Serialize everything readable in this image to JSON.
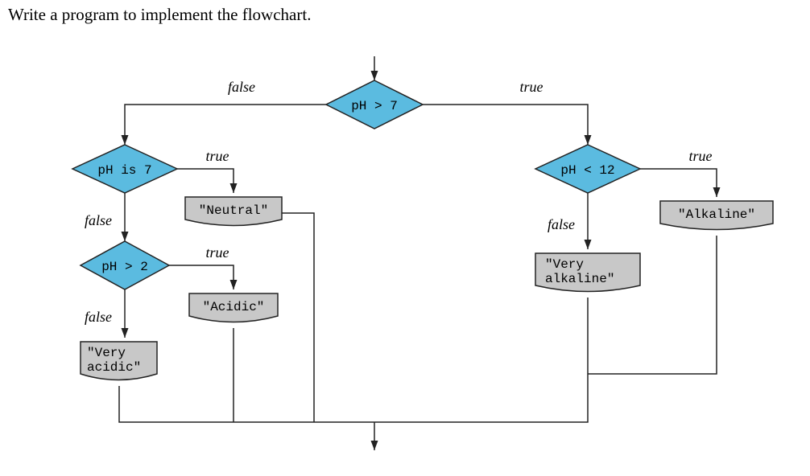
{
  "prompt": "Write a program to implement the flowchart.",
  "chart_data": {
    "type": "flowchart",
    "nodes": [
      {
        "id": "d1",
        "kind": "decision",
        "text": "pH > 7"
      },
      {
        "id": "d2",
        "kind": "decision",
        "text": "pH is 7"
      },
      {
        "id": "d3",
        "kind": "decision",
        "text": "pH > 2"
      },
      {
        "id": "d4",
        "kind": "decision",
        "text": "pH < 12"
      },
      {
        "id": "o1",
        "kind": "output",
        "text": "\"Neutral\""
      },
      {
        "id": "o2",
        "kind": "output",
        "text": "\"Acidic\""
      },
      {
        "id": "o3",
        "kind": "output",
        "text": "\"Very\nacidic\""
      },
      {
        "id": "o4",
        "kind": "output",
        "text": "\"Very\nalkaline\""
      },
      {
        "id": "o5",
        "kind": "output",
        "text": "\"Alkaline\""
      }
    ],
    "edges": [
      {
        "from": "d1",
        "to": "d2",
        "label": "false"
      },
      {
        "from": "d1",
        "to": "d4",
        "label": "true"
      },
      {
        "from": "d2",
        "to": "o1",
        "label": "true"
      },
      {
        "from": "d2",
        "to": "d3",
        "label": "false"
      },
      {
        "from": "d3",
        "to": "o2",
        "label": "true"
      },
      {
        "from": "d3",
        "to": "o3",
        "label": "false"
      },
      {
        "from": "d4",
        "to": "o5",
        "label": "true"
      },
      {
        "from": "d4",
        "to": "o4",
        "label": "false"
      },
      {
        "from": "o1",
        "to": "end"
      },
      {
        "from": "o2",
        "to": "end"
      },
      {
        "from": "o3",
        "to": "end"
      },
      {
        "from": "o4",
        "to": "end"
      },
      {
        "from": "o5",
        "to": "end"
      }
    ]
  },
  "labels": {
    "false": "false",
    "true": "true"
  }
}
